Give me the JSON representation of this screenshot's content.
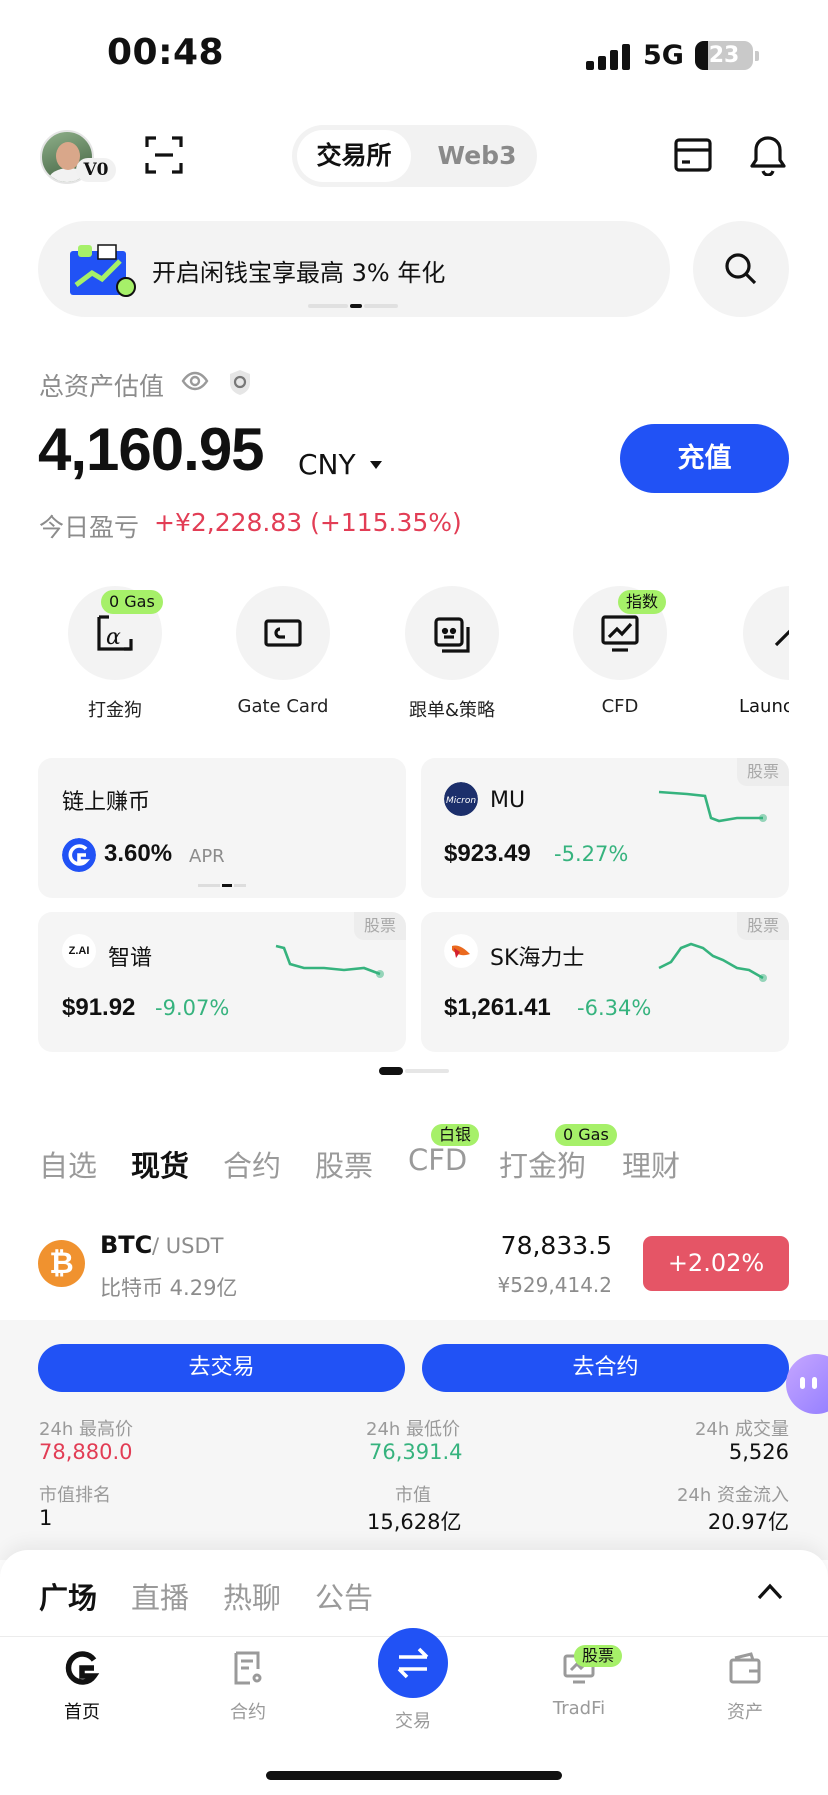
{
  "status": {
    "time": "00:48",
    "network": "5G",
    "battery": "23",
    "battery_level": 0.23
  },
  "header": {
    "vip": "V0",
    "segments": [
      "交易所",
      "Web3"
    ],
    "active_segment": "交易所"
  },
  "banner": {
    "text": "开启闲钱宝享最高 3% 年化"
  },
  "assets": {
    "label": "总资产估值",
    "value": "4,160.95",
    "currency": "CNY",
    "deposit_label": "充值",
    "pnl_label": "今日盈亏",
    "pnl_value": "+¥2,228.83 (+115.35%)"
  },
  "quick_actions": [
    {
      "label": "打金狗",
      "badge": "0 Gas",
      "icon": "alpha-icon"
    },
    {
      "label": "Gate Card",
      "badge": "",
      "icon": "card-icon"
    },
    {
      "label": "跟单&策略",
      "badge": "",
      "icon": "copy-trade-icon"
    },
    {
      "label": "CFD",
      "badge": "指数",
      "icon": "chart-monitor-icon"
    },
    {
      "label": "Launc",
      "badge": "",
      "icon": "launch-icon"
    }
  ],
  "tiles": [
    {
      "name": "链上赚币",
      "value": "3.60%",
      "unit": "APR"
    },
    {
      "name": "MU",
      "price": "$923.49",
      "change": "-5.27%",
      "tag": "股票"
    },
    {
      "name": "智谱",
      "price": "$91.92",
      "change": "-9.07%",
      "tag": "股票",
      "logo_text": "Z.AI"
    },
    {
      "name": "SK海力士",
      "price": "$1,261.41",
      "change": "-6.34%",
      "tag": "股票"
    }
  ],
  "market_tabs": [
    {
      "label": "自选",
      "badge": ""
    },
    {
      "label": "现货",
      "badge": "",
      "active": true
    },
    {
      "label": "合约",
      "badge": ""
    },
    {
      "label": "股票",
      "badge": ""
    },
    {
      "label": "CFD",
      "badge": "白银"
    },
    {
      "label": "打金狗",
      "badge": "0 Gas"
    },
    {
      "label": "理财",
      "badge": ""
    }
  ],
  "btc": {
    "symbol": "BTC",
    "quote": "/ USDT",
    "sub": "比特币 4.29亿",
    "price": "78,833.5",
    "price_cny": "¥529,414.2",
    "change": "+2.02%"
  },
  "detail": {
    "trade_btn": "去交易",
    "futures_btn": "去合约",
    "stats": [
      {
        "label": "24h 最高价",
        "value": "78,880.0"
      },
      {
        "label": "24h 最低价",
        "value": "76,391.4"
      },
      {
        "label": "24h 成交量",
        "value": "5,526"
      },
      {
        "label": "市值排名",
        "value": "1"
      },
      {
        "label": "市值",
        "value": "15,628亿"
      },
      {
        "label": "24h 资金流入",
        "value": "20.97亿"
      }
    ]
  },
  "sheet_tabs": [
    "广场",
    "直播",
    "热聊",
    "公告"
  ],
  "tabbar": [
    {
      "label": "首页",
      "icon": "gate-home-icon"
    },
    {
      "label": "合约",
      "icon": "futures-doc-icon"
    },
    {
      "label": "交易",
      "icon": "swap-icon"
    },
    {
      "label": "TradFi",
      "icon": "tradfi-icon",
      "badge": "股票"
    },
    {
      "label": "资产",
      "icon": "wallet-icon"
    }
  ],
  "colors": {
    "accent": "#2152f5",
    "up": "#e23d55",
    "down": "#36b37e",
    "badge": "#a6f069"
  }
}
